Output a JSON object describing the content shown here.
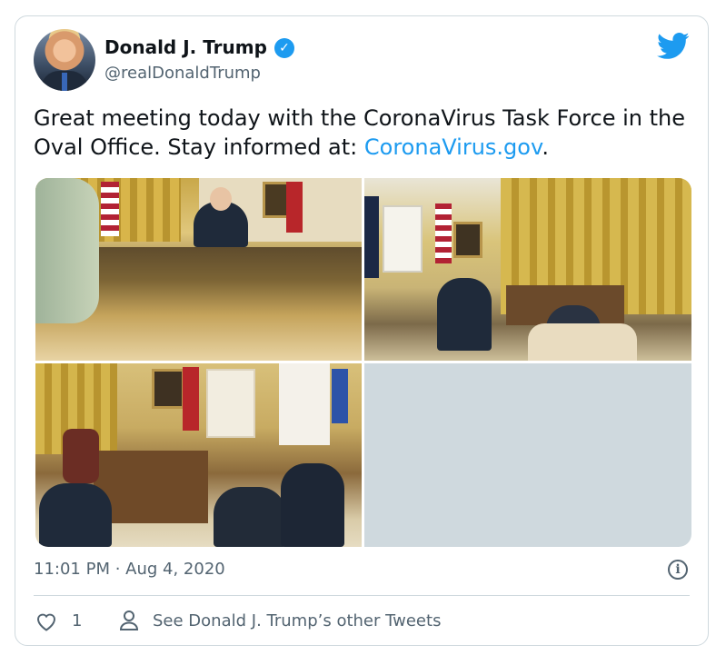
{
  "tweet": {
    "author_name": "Donald J. Trump",
    "handle": "@realDonaldTrump",
    "verified_icon": "verified-badge-icon",
    "text_main": "Great meeting today with the CoronaVirus Task Force in the Oval Office. Stay informed at: ",
    "link_text": "CoronaVirus.gov",
    "text_end": ".",
    "timestamp": "11:01 PM · Aug 4, 2020",
    "likes": "1",
    "other_tweets_label": "See Donald J. Trump’s other Tweets"
  },
  "icons": {
    "brand": "twitter-bird-icon",
    "info": "info-icon",
    "like": "heart-icon",
    "profile": "person-icon"
  },
  "colors": {
    "accent": "#1d9bf0",
    "secondary_text": "#536471",
    "border": "#cfd9de"
  }
}
